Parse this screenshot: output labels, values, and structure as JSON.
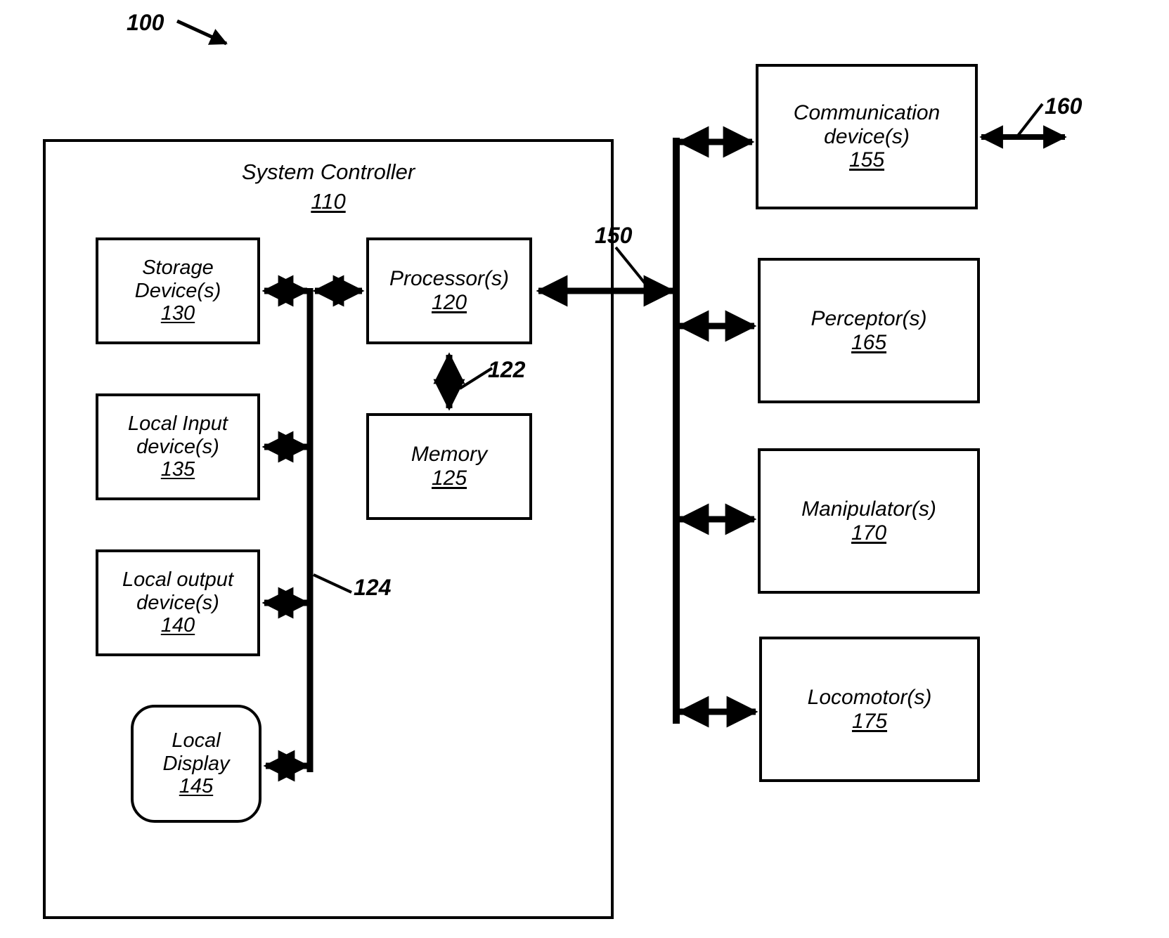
{
  "figure": {
    "ref_label": "100",
    "system_controller": {
      "title": "System Controller",
      "number": "110"
    }
  },
  "internal_blocks": [
    {
      "name": "storage-device",
      "line1": "Storage",
      "line2": "Device(s)",
      "number": "130",
      "shape": "rect"
    },
    {
      "name": "local-input-device",
      "line1": "Local Input",
      "line2": "device(s)",
      "number": "135",
      "shape": "rect"
    },
    {
      "name": "local-output-device",
      "line1": "Local output",
      "line2": "device(s)",
      "number": "140",
      "shape": "rect"
    },
    {
      "name": "local-display",
      "line1": "Local",
      "line2": "Display",
      "number": "145",
      "shape": "rounded"
    },
    {
      "name": "processor",
      "line1": "Processor(s)",
      "line2": "",
      "number": "120",
      "shape": "rect"
    },
    {
      "name": "memory",
      "line1": "Memory",
      "line2": "",
      "number": "125",
      "shape": "rect"
    }
  ],
  "external_blocks": [
    {
      "name": "communication-device",
      "line1": "Communication",
      "line2": "device(s)",
      "number": "155",
      "shape": "rect"
    },
    {
      "name": "perceptor",
      "line1": "Perceptor(s)",
      "line2": "",
      "number": "165",
      "shape": "rect"
    },
    {
      "name": "manipulator",
      "line1": "Manipulator(s)",
      "line2": "",
      "number": "170",
      "shape": "rect"
    },
    {
      "name": "locomotor",
      "line1": "Locomotor(s)",
      "line2": "",
      "number": "175",
      "shape": "rect"
    }
  ],
  "connection_labels": {
    "processor_memory_bus": "122",
    "internal_bus": "124",
    "system_bus": "150",
    "external_network": "160"
  },
  "colors": {
    "stroke": "#000000",
    "fill": "#ffffff"
  }
}
